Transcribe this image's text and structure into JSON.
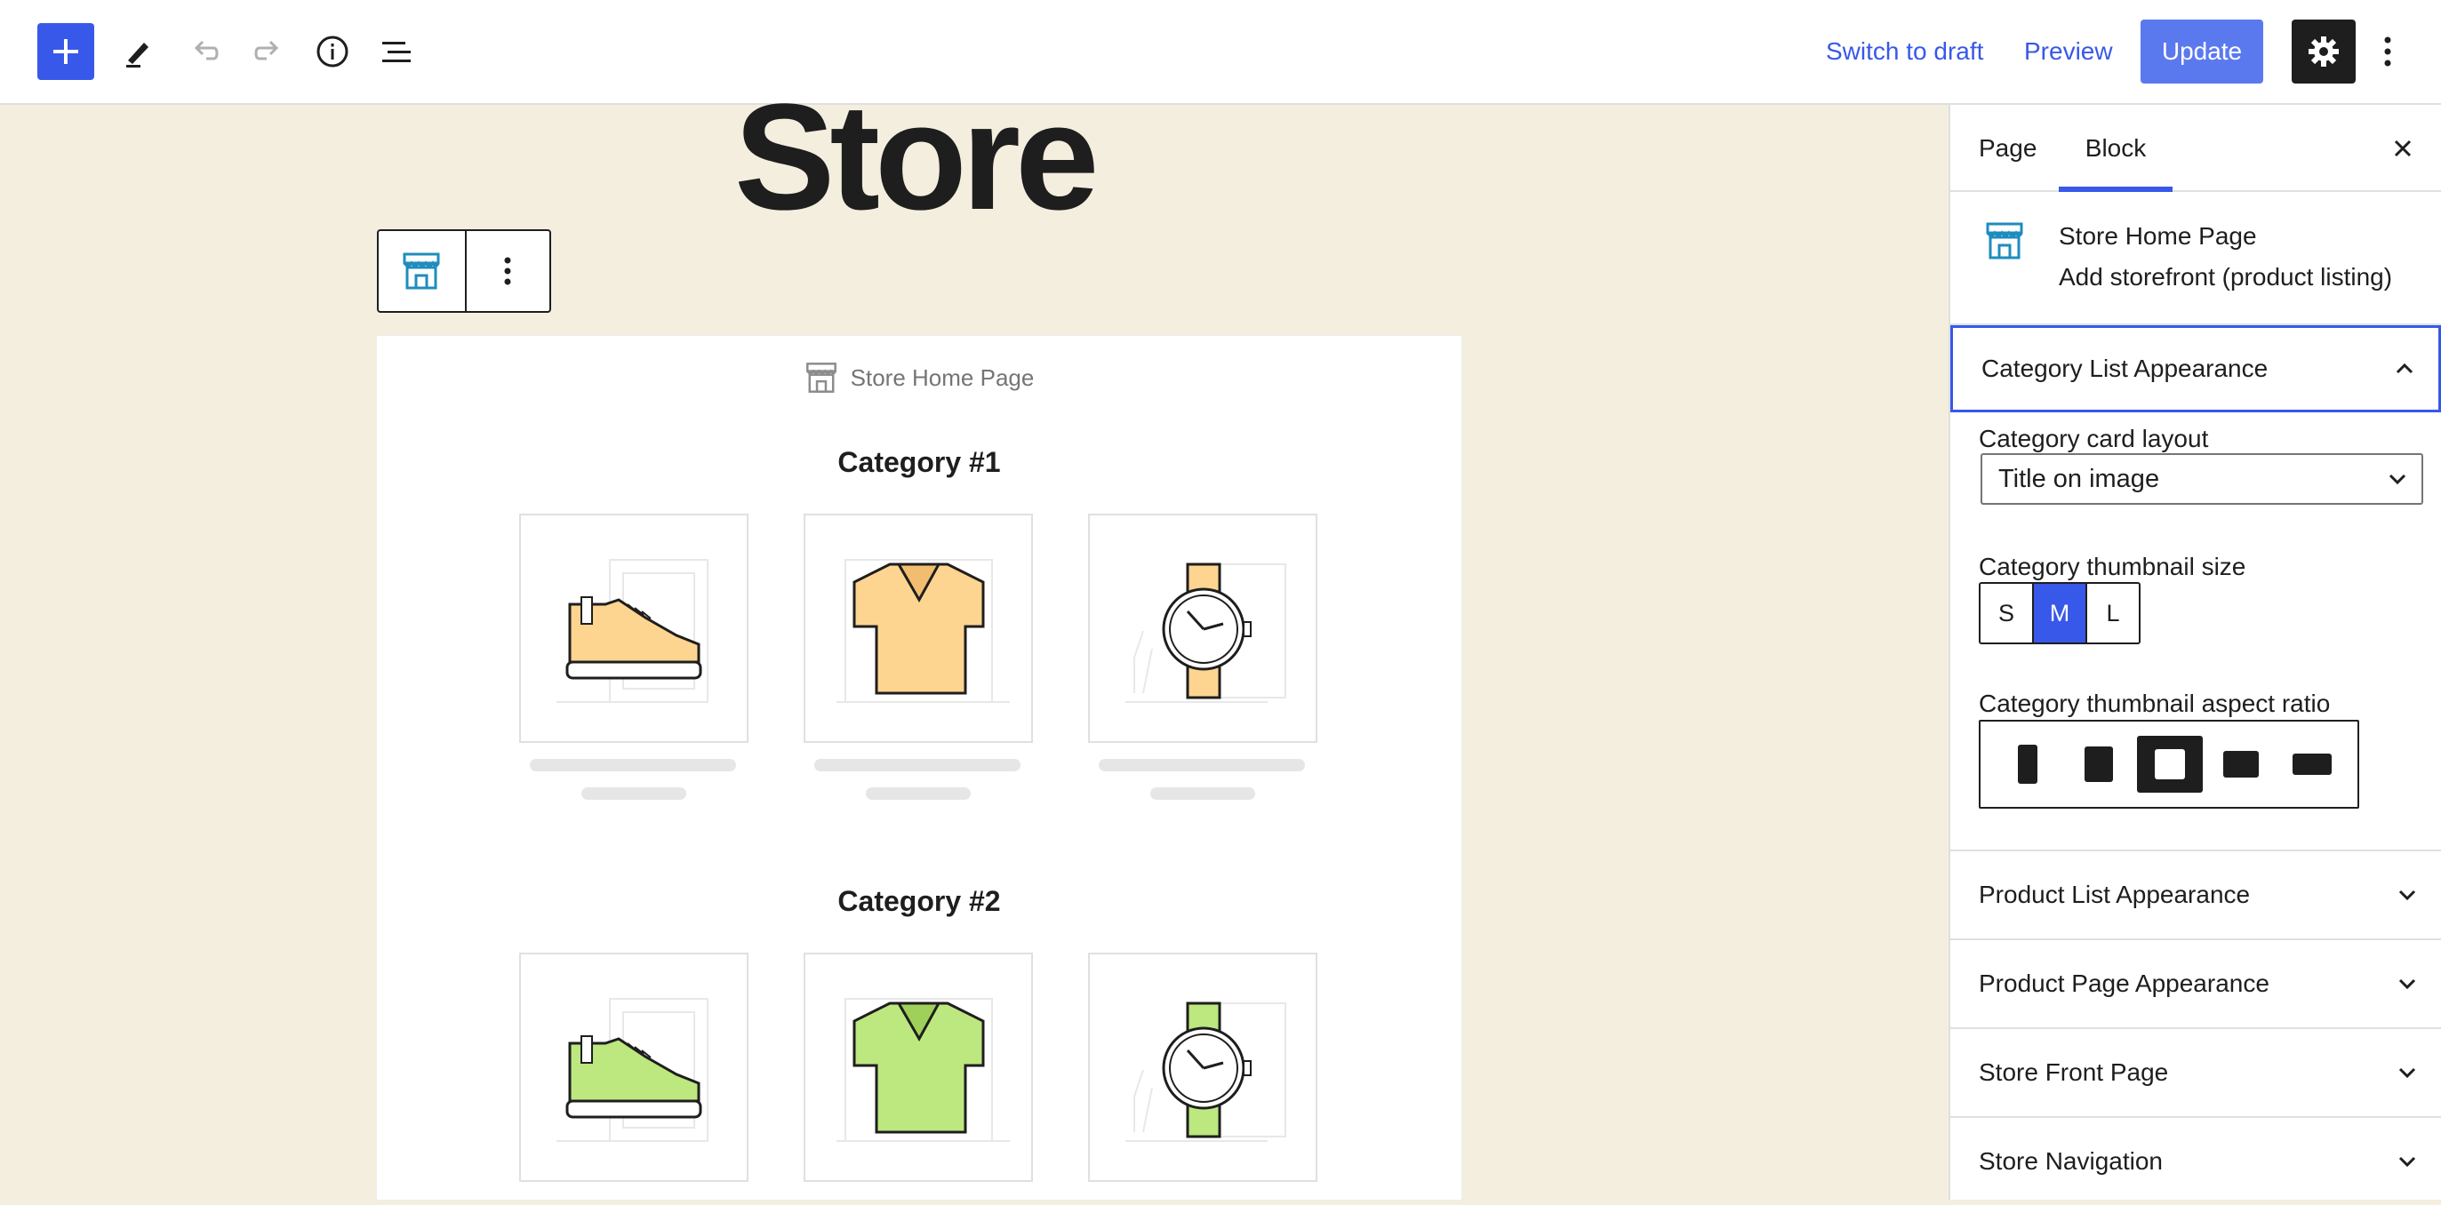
{
  "toolbar": {
    "switch_to_draft": "Switch to draft",
    "preview": "Preview",
    "update": "Update",
    "icons": [
      "plus-icon",
      "pencil-icon",
      "undo-icon",
      "redo-icon",
      "info-icon",
      "list-view-icon",
      "gear-icon",
      "more-vertical-icon"
    ]
  },
  "page": {
    "title": "Store"
  },
  "block": {
    "label": "Store Home Page",
    "categories": [
      {
        "title": "Category #1",
        "color": "#fdd590"
      },
      {
        "title": "Category #2",
        "color": "#bde77f"
      }
    ]
  },
  "sidebar": {
    "tabs": {
      "page": "Page",
      "block": "Block"
    },
    "block_card": {
      "title": "Store Home Page",
      "description": "Add storefront (product listing)"
    },
    "open_panel": {
      "title": "Category List Appearance",
      "layout_label": "Category card layout",
      "layout_value": "Title on image",
      "size_label": "Category thumbnail size",
      "sizes": [
        "S",
        "M",
        "L"
      ],
      "selected_size": "M",
      "aspect_label": "Category thumbnail aspect ratio",
      "selected_aspect_index": 2
    },
    "panels": [
      "Product List Appearance",
      "Product Page Appearance",
      "Store Front Page",
      "Store Navigation"
    ]
  },
  "colors": {
    "accent": "#3858e9",
    "canvas": "#f4eedf",
    "store_icon": "#1e8cbe"
  }
}
